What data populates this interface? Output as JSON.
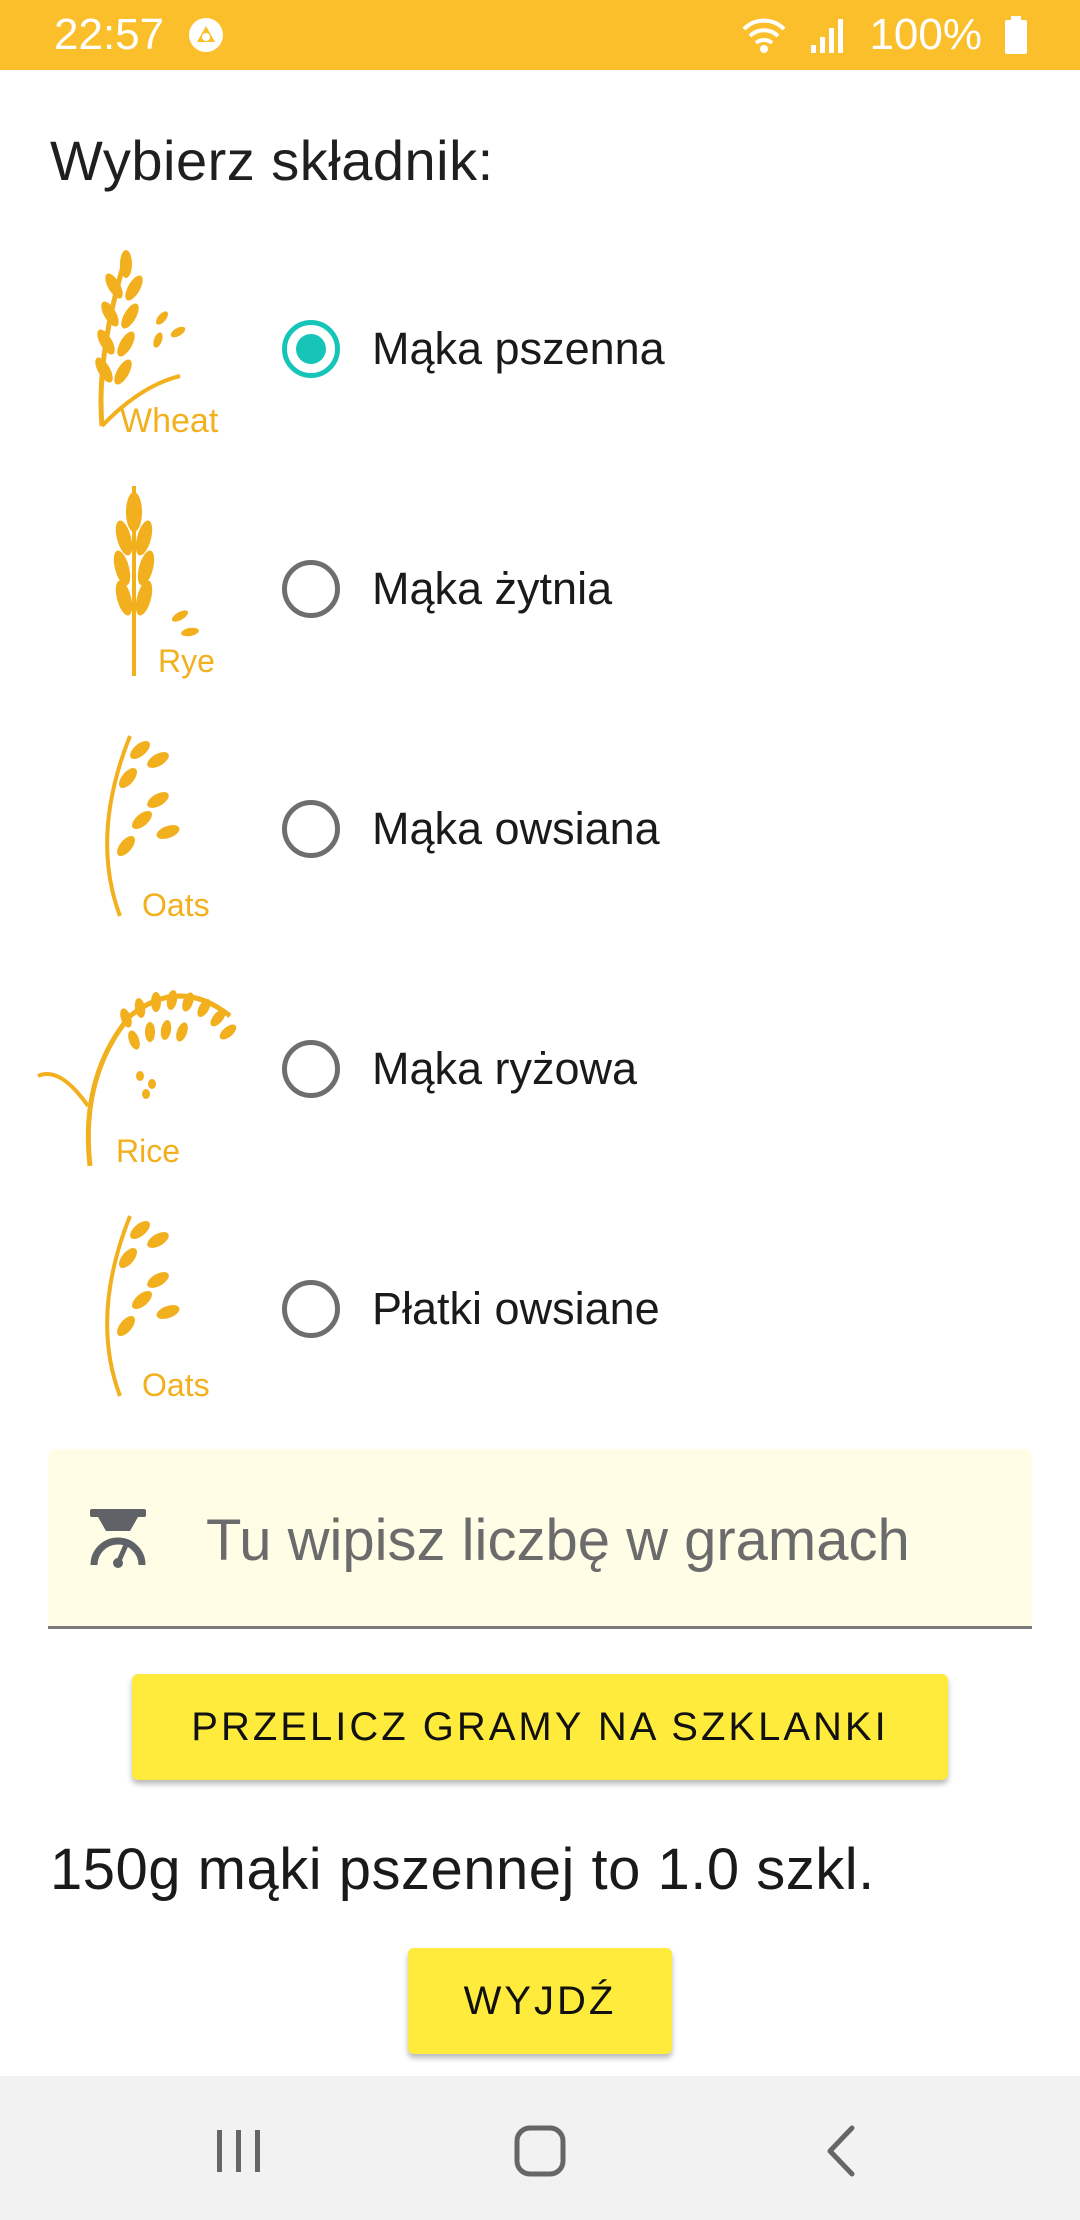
{
  "status_bar": {
    "time": "22:57",
    "battery": "100%",
    "icons": [
      "notification-icon",
      "wifi-icon",
      "signal-icon",
      "battery-icon"
    ],
    "background": "#fbbf2c"
  },
  "heading": "Wybierz składnik:",
  "options": [
    {
      "label": "Mąka pszenna",
      "image_text": "Wheat",
      "selected": true
    },
    {
      "label": "Mąka żytnia",
      "image_text": "Rye",
      "selected": false
    },
    {
      "label": "Mąka owsiana",
      "image_text": "Oats",
      "selected": false
    },
    {
      "label": "Mąka ryżowa",
      "image_text": "Rice",
      "selected": false
    },
    {
      "label": "Płatki owsiane",
      "image_text": "Oats",
      "selected": false
    }
  ],
  "input": {
    "placeholder": "Tu wipisz liczbę w gramach",
    "value": "",
    "icon": "scale-icon"
  },
  "convert_button": "PRZELICZ GRAMY NA SZKLANKI",
  "result": "150g mąki pszennej to 1.0 szkl.",
  "exit_button": "WYJDŹ",
  "colors": {
    "accent": "#17c5b8",
    "button": "#ffeb3b",
    "grain": "#f2b01e",
    "input_bg": "#fffde6"
  },
  "nav_bar": {
    "icons": [
      "recent-apps-icon",
      "home-icon",
      "back-icon"
    ]
  }
}
